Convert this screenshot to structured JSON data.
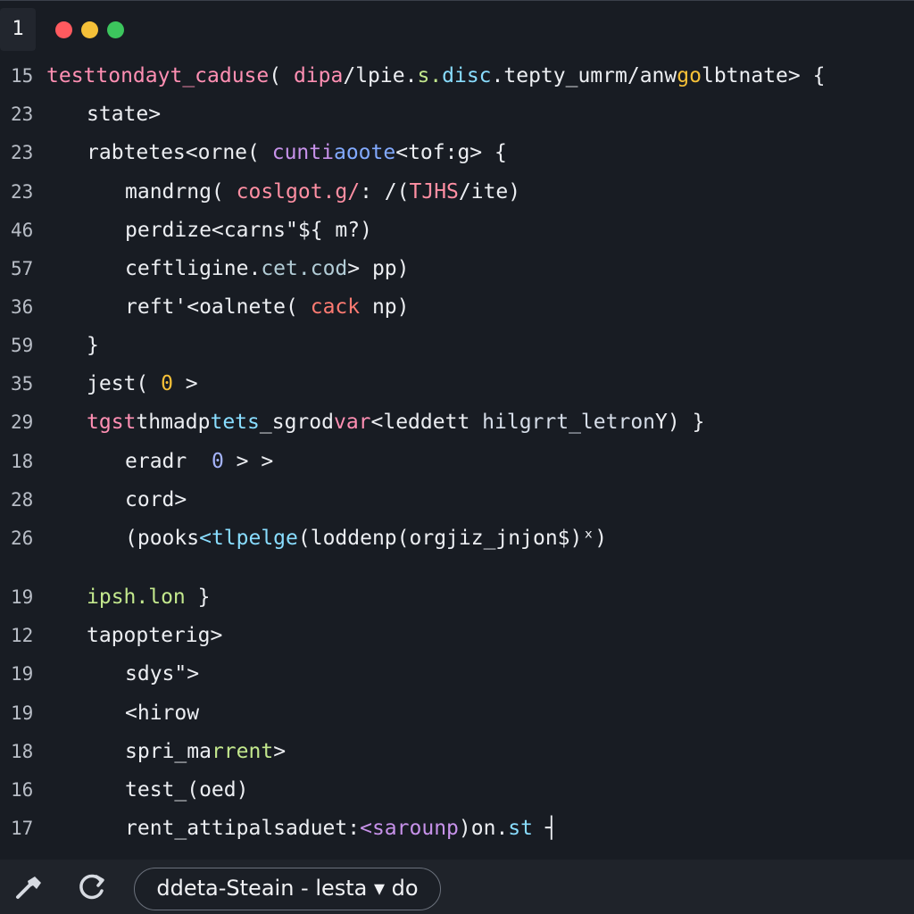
{
  "window": {
    "tab_number": "1",
    "controls": {
      "close_color": "#ff5a5f",
      "minimize_color": "#f5c038",
      "maximize_color": "#3cc55d"
    }
  },
  "editor": {
    "lines": [
      {
        "number": "15",
        "segments": [
          {
            "text": "testtondayt_caduse",
            "color": "#ff8fb3"
          },
          {
            "text": "( ",
            "color": "#eceef2"
          },
          {
            "text": "dipa",
            "color": "#ff8fb3"
          },
          {
            "text": "/lpie.",
            "color": "#eceef2"
          },
          {
            "text": "s.",
            "color": "#c3e88d"
          },
          {
            "text": "disc",
            "color": "#89ddff"
          },
          {
            "text": ".tepty_umr",
            "color": "#eceef2"
          },
          {
            "text": "m/anw",
            "color": "#eceef2"
          },
          {
            "text": "go",
            "color": "#f5c038"
          },
          {
            "text": "lbtnate> {",
            "color": "#eceef2"
          }
        ]
      },
      {
        "number": "23",
        "segments": [
          {
            "text": "state>",
            "color": "#eceef2"
          }
        ]
      },
      {
        "number": "23",
        "segments": [
          {
            "text": "rabtetes<orne( ",
            "color": "#eceef2"
          },
          {
            "text": "cunti",
            "color": "#c792ea"
          },
          {
            "text": "aoote",
            "color": "#82aaff"
          },
          {
            "text": "<tof:g> {",
            "color": "#eceef2"
          }
        ]
      },
      {
        "number": "23",
        "segments": [
          {
            "text": "mandrng( ",
            "color": "#eceef2"
          },
          {
            "text": "coslgot.g/",
            "color": "#ff8fa3"
          },
          {
            "text": ": /(",
            "color": "#eceef2"
          },
          {
            "text": "TJHS",
            "color": "#ff8fa3"
          },
          {
            "text": "/ite)",
            "color": "#eceef2"
          }
        ]
      },
      {
        "number": "46",
        "segments": [
          {
            "text": "perdize<carns\"${ m?)",
            "color": "#eceef2"
          }
        ]
      },
      {
        "number": "57",
        "segments": [
          {
            "text": "ceftligine.",
            "color": "#eceef2"
          },
          {
            "text": "cet.cod",
            "color": "#b2ccd6"
          },
          {
            "text": "> pp)",
            "color": "#eceef2"
          }
        ]
      },
      {
        "number": "36",
        "segments": [
          {
            "text": "reft'<oalnete( ",
            "color": "#eceef2"
          },
          {
            "text": "cack",
            "color": "#ff7b72"
          },
          {
            "text": " np)",
            "color": "#eceef2"
          }
        ]
      },
      {
        "number": "59",
        "segments": [
          {
            "text": "}",
            "color": "#eceef2"
          }
        ]
      },
      {
        "number": "35",
        "segments": [
          {
            "text": "jest( ",
            "color": "#eceef2"
          },
          {
            "text": "0",
            "color": "#f5c038"
          },
          {
            "text": " >",
            "color": "#eceef2"
          }
        ]
      },
      {
        "number": "29",
        "segments": [
          {
            "text": "tgst",
            "color": "#ff8fb3"
          },
          {
            "text": "thmadp",
            "color": "#eceef2"
          },
          {
            "text": "tets",
            "color": "#89ddff"
          },
          {
            "text": "_sgrod",
            "color": "#eceef2"
          },
          {
            "text": "var",
            "color": "#ff8fb3"
          },
          {
            "text": "<ledd",
            "color": "#eceef2"
          },
          {
            "text": "ett ",
            "color": "#eceef2"
          },
          {
            "text": "hilgrrt_letron",
            "color": "#d6dde8"
          },
          {
            "text": "Y) }",
            "color": "#eceef2"
          }
        ]
      },
      {
        "number": "18",
        "segments": [
          {
            "text": "eradr  ",
            "color": "#eceef2"
          },
          {
            "text": "0",
            "color": "#a5b4fc"
          },
          {
            "text": " > >",
            "color": "#eceef2"
          }
        ]
      },
      {
        "number": "28",
        "segments": [
          {
            "text": "cord>",
            "color": "#eceef2"
          }
        ]
      },
      {
        "number": "26",
        "segments": [
          {
            "text": "(pooks",
            "color": "#eceef2"
          },
          {
            "text": "<tlpelge",
            "color": "#89ddff"
          },
          {
            "text": "(loddenp(orgjiz_jnjon$)",
            "color": "#eceef2"
          },
          {
            "text": "ˣ)",
            "color": "#eceef2"
          }
        ]
      },
      {
        "number": "19",
        "segments": [
          {
            "text": "ipsh.lon",
            "color": "#c3e88d"
          },
          {
            "text": " }",
            "color": "#eceef2"
          }
        ]
      },
      {
        "number": "12",
        "segments": [
          {
            "text": "tapopterig>",
            "color": "#eceef2"
          }
        ]
      },
      {
        "number": "19",
        "segments": [
          {
            "text": "sdys\">",
            "color": "#eceef2"
          }
        ]
      },
      {
        "number": "19",
        "segments": [
          {
            "text": "<hirow",
            "color": "#eceef2"
          }
        ]
      },
      {
        "number": "18",
        "segments": [
          {
            "text": "spri_ma",
            "color": "#eceef2"
          },
          {
            "text": "rrent",
            "color": "#c3e88d"
          },
          {
            "text": ">",
            "color": "#eceef2"
          }
        ]
      },
      {
        "number": "16",
        "segments": [
          {
            "text": "test_(oed)",
            "color": "#eceef2"
          }
        ]
      },
      {
        "number": "17",
        "segments": [
          {
            "text": "rent_attipalsaduet:",
            "color": "#eceef2"
          },
          {
            "text": "<saro",
            "color": "#c792ea"
          },
          {
            "text": "unp",
            "color": "#c792ea"
          },
          {
            "text": ")on.",
            "color": "#eceef2"
          },
          {
            "text": "st",
            "color": "#89ddff"
          },
          {
            "text": " ┤",
            "color": "#eceef2"
          }
        ]
      }
    ]
  },
  "statusbar": {
    "left_icon": "hammer-icon",
    "refresh_icon": "refresh-icon",
    "branch_label": "ddeta-Steain - lesta ▾ do"
  }
}
